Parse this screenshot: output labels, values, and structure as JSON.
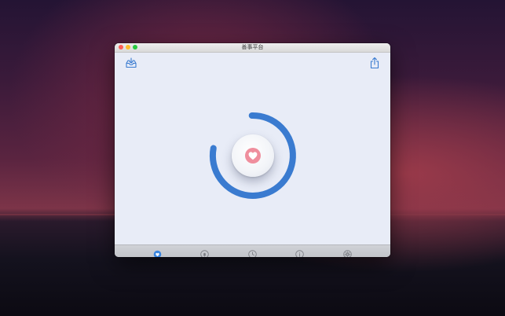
{
  "window": {
    "title": "善事平台"
  },
  "toolbar": {
    "left_icon": "inbox-download-icon",
    "right_icon": "share-icon"
  },
  "main": {
    "center_icon": "heart-icon",
    "ring_color": "#3a7bd0",
    "heart_color": "#ef8e9d"
  },
  "tabs": [
    {
      "icon": "shield-heart-icon",
      "active": true
    },
    {
      "icon": "bell-icon",
      "active": false
    },
    {
      "icon": "clock-icon",
      "active": false
    },
    {
      "icon": "info-icon",
      "active": false
    },
    {
      "icon": "settings-icon",
      "active": false
    }
  ],
  "colors": {
    "accent": "#3a7bd0",
    "tab_active": "#3b86e0",
    "tab_inactive": "#7d7f85",
    "window_bg": "#e8ecf7"
  }
}
